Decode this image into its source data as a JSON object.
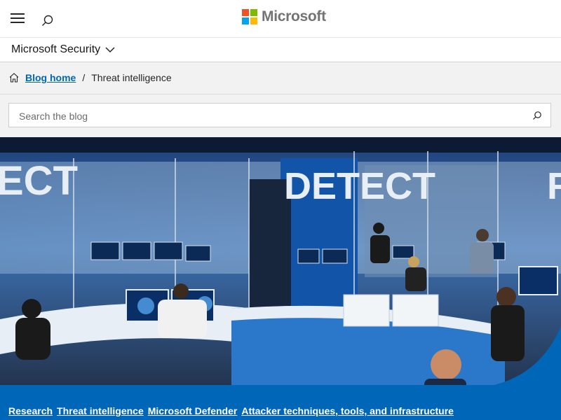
{
  "header": {
    "menu_icon": "hamburger-menu-icon",
    "search_icon": "search-icon",
    "logo_text": "Microsoft",
    "logo_colors": [
      "#f25022",
      "#7fba00",
      "#00a4ef",
      "#ffb900"
    ]
  },
  "product": {
    "title": "Microsoft Security",
    "chevron_icon": "chevron-down-icon"
  },
  "breadcrumb": {
    "home_icon": "home-icon",
    "home_label": "Blog home",
    "separator": "/",
    "current": "Threat intelligence"
  },
  "search": {
    "placeholder": "Search the blog",
    "value": ""
  },
  "hero": {
    "sign_left": "ECT",
    "sign_center": "DETECT",
    "sign_right": "R",
    "description": ""
  },
  "tags": [
    "Research",
    "Threat intelligence",
    "Microsoft Defender",
    "Attacker techniques, tools, and infrastructure"
  ],
  "colors": {
    "accent": "#0067b8",
    "crumb_bg": "#f2f2f2"
  }
}
